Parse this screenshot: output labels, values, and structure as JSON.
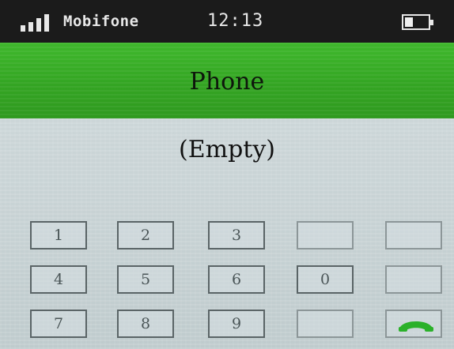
{
  "status_bar": {
    "carrier": "Mobifone",
    "time": "12:13",
    "signal_bars": 4,
    "battery_level": 0.35
  },
  "header": {
    "title": "Phone"
  },
  "main": {
    "empty_text": "(Empty)"
  },
  "keypad": {
    "rows": [
      [
        "1",
        "2",
        "3",
        "",
        ""
      ],
      [
        "4",
        "5",
        "6",
        "0",
        ""
      ],
      [
        "7",
        "8",
        "9",
        "",
        ""
      ]
    ],
    "call_icon": "phone-handset-icon"
  },
  "colors": {
    "status_bar_bg": "#1b1b1b",
    "title_bar_bg": "#34a523",
    "screen_bg": "#c7d2d4",
    "call_icon": "#2bb12a"
  }
}
